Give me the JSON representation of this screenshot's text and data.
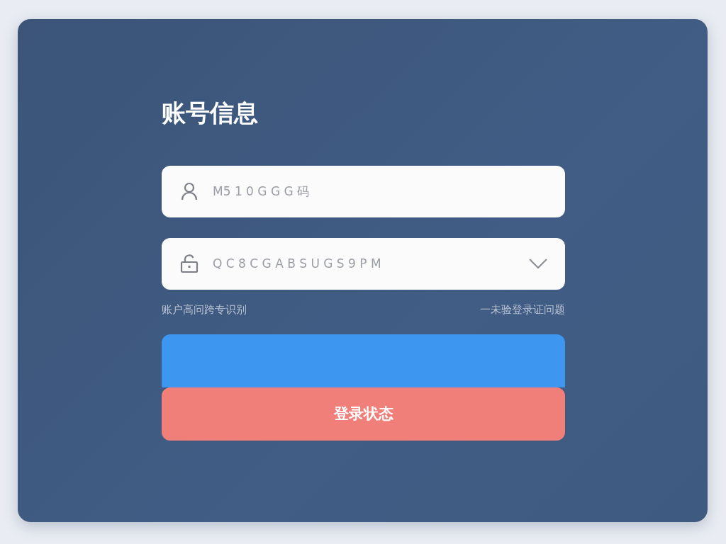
{
  "title": "账号信息",
  "fields": [
    {
      "kind": "user",
      "placeholder": "M5 1 0 G G G 码",
      "dropdown": false
    },
    {
      "kind": "lock",
      "placeholder": "Q C 8 C G A B S U G S 9 P M",
      "dropdown": true
    }
  ],
  "links": [
    {
      "label": "账户高问跨专识别"
    },
    {
      "label": "一未验登录证问题"
    }
  ],
  "buttons": [
    {
      "kind": "blue"
    },
    {
      "kind": "red",
      "label": "登录状态"
    }
  ]
}
